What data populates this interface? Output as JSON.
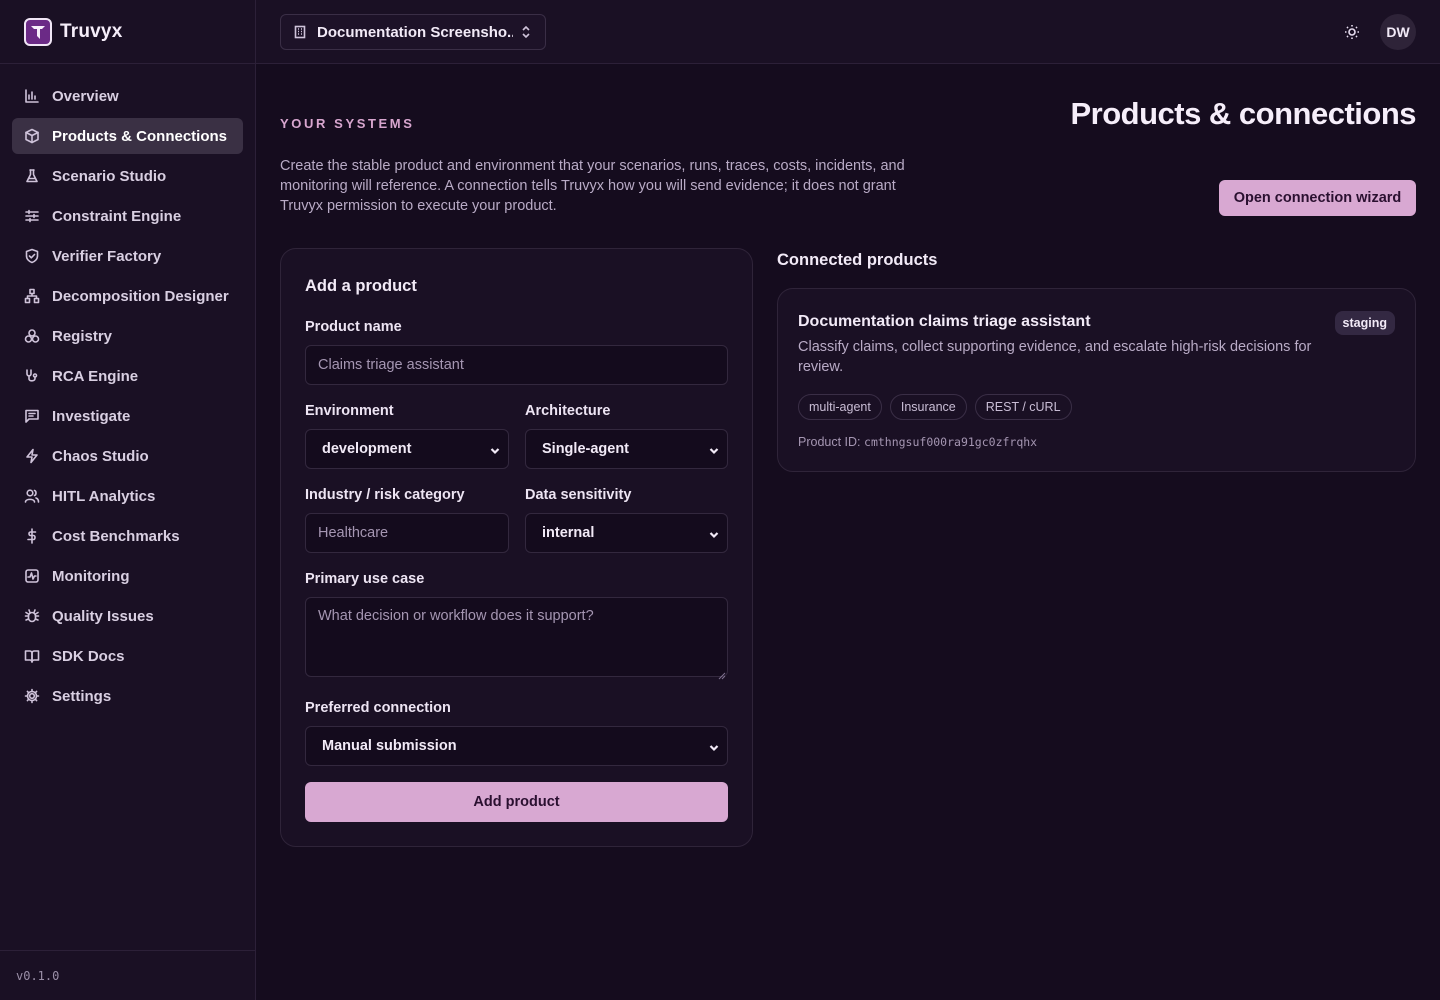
{
  "brand": {
    "name": "Truvyx"
  },
  "sidebar": {
    "items": [
      {
        "label": "Overview",
        "icon": "bar-chart-icon"
      },
      {
        "label": "Products & Connections",
        "icon": "cube-icon",
        "active": true
      },
      {
        "label": "Scenario Studio",
        "icon": "flask-icon"
      },
      {
        "label": "Constraint Engine",
        "icon": "sliders-icon"
      },
      {
        "label": "Verifier Factory",
        "icon": "shield-check-icon"
      },
      {
        "label": "Decomposition Designer",
        "icon": "hierarchy-icon"
      },
      {
        "label": "Registry",
        "icon": "boxes-icon"
      },
      {
        "label": "RCA Engine",
        "icon": "stethoscope-icon"
      },
      {
        "label": "Investigate",
        "icon": "message-icon"
      },
      {
        "label": "Chaos Studio",
        "icon": "lightning-icon"
      },
      {
        "label": "HITL Analytics",
        "icon": "users-icon"
      },
      {
        "label": "Cost Benchmarks",
        "icon": "dollar-icon"
      },
      {
        "label": "Monitoring",
        "icon": "activity-icon"
      },
      {
        "label": "Quality Issues",
        "icon": "bug-icon"
      },
      {
        "label": "SDK Docs",
        "icon": "book-icon"
      },
      {
        "label": "Settings",
        "icon": "gear-icon"
      }
    ],
    "version": "v0.1.0"
  },
  "header": {
    "workspace": "Documentation Screensho...",
    "avatar_initials": "DW"
  },
  "main": {
    "eyebrow": "YOUR SYSTEMS",
    "title": "Products & connections",
    "description": "Create the stable product and environment that your scenarios, runs, traces, costs, incidents, and monitoring will reference. A connection tells Truvyx how you will send evidence; it does not grant Truvyx permission to execute your product.",
    "wizard_button": "Open connection wizard"
  },
  "form": {
    "heading": "Add a product",
    "product_name_label": "Product name",
    "product_name_placeholder": "Claims triage assistant",
    "environment_label": "Environment",
    "environment_value": "development",
    "architecture_label": "Architecture",
    "architecture_value": "Single-agent",
    "industry_label": "Industry / risk category",
    "industry_placeholder": "Healthcare",
    "sensitivity_label": "Data sensitivity",
    "sensitivity_value": "internal",
    "use_case_label": "Primary use case",
    "use_case_placeholder": "What decision or workflow does it support?",
    "connection_label": "Preferred connection",
    "connection_value": "Manual submission",
    "submit_label": "Add product"
  },
  "connected": {
    "title": "Connected products",
    "products": [
      {
        "name": "Documentation claims triage assistant",
        "badge": "staging",
        "description": "Classify claims, collect supporting evidence, and escalate high-risk decisions for review.",
        "tags": [
          "multi-agent",
          "Insurance",
          "REST / cURL"
        ],
        "id_label": "Product ID:",
        "id_value": "cmthngsuf000ra91gc0zfrqhx"
      }
    ]
  },
  "colors": {
    "background": "#150c1e",
    "accent": "#d8a8d2",
    "eyebrow": "#d8a6cf"
  }
}
